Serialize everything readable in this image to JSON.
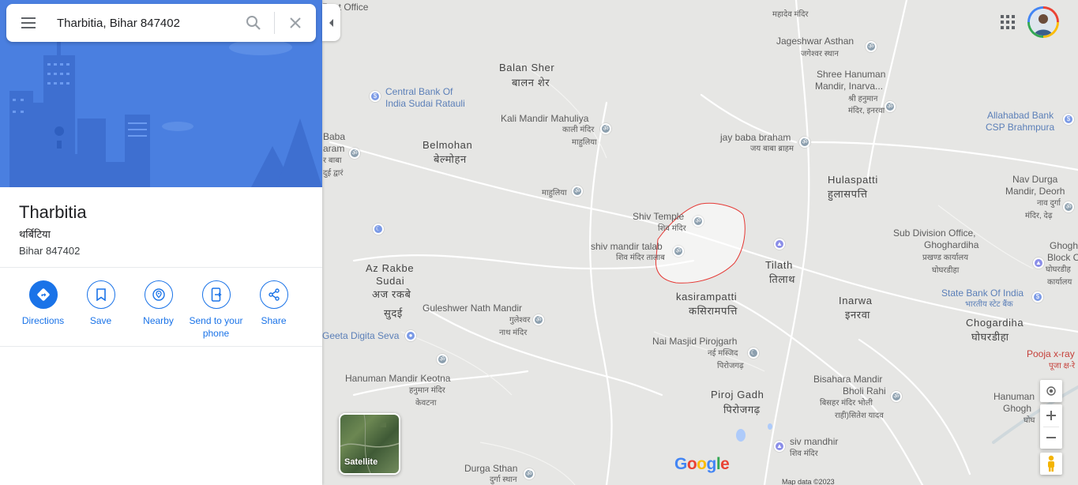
{
  "search": {
    "value": "Tharbitia, Bihar 847402"
  },
  "place": {
    "title": "Tharbitia",
    "local_name": "थर्बिटिया",
    "address": "Bihar 847402"
  },
  "actions": [
    {
      "label": "Directions",
      "icon": "directions-icon"
    },
    {
      "label": "Save",
      "icon": "bookmark-icon"
    },
    {
      "label": "Nearby",
      "icon": "nearby-icon"
    },
    {
      "label": "Send to your phone",
      "icon": "send-to-phone-icon"
    },
    {
      "label": "Share",
      "icon": "share-icon"
    }
  ],
  "map": {
    "satellite_label": "Satellite",
    "google_logo": "Google",
    "footer": "Map data ©2023",
    "labels": {
      "post_office": "Post Office",
      "mahadev_mandir": "महादेव मंदिर",
      "jageshwar_asthan": "Jageshwar Asthan",
      "jageshwar_hi": "जगेश्वर स्थान",
      "balan_sher": "Balan Sher",
      "balan_sher_hi": "बालन शेर",
      "central_bank_1": "Central Bank Of",
      "central_bank_2": "India Sudai Ratauli",
      "shree_hanuman_1": "Shree Hanuman",
      "shree_hanuman_2": "Mandir, Inarva...",
      "shree_hanuman_hi1": "श्री हनुमान",
      "shree_hanuman_hi2": "मंदिर, इनरवा",
      "allahabad_1": "Allahabad Bank",
      "allahabad_2": "CSP Brahmpura",
      "kali_mandir": "Kali Mandir Mahuliya",
      "kali_mandir_hi1": "काली मंदिर",
      "kali_mandir_hi2": "माहुलिया",
      "baba_1": "Baba",
      "baba_2": "aram",
      "baba_3": "र बाबा",
      "baba_4": "दुई द्वारं",
      "belmohan": "Belmohan",
      "belmohan_hi": "बेल्मोहन",
      "jay_baba": "jay baba braham",
      "jay_baba_hi": "जय बाबा ब्राहम",
      "hulaspatti": "Hulaspatti",
      "hulaspatti_hi": "हुलासपत्ति",
      "nav_durga_1": "Nav Durga",
      "nav_durga_2": "Mandir, Deorh",
      "nav_durga_hi1": "नाव दुर्गा",
      "nav_durga_hi2": "मंदिर, देढ़",
      "mahuliya_hi": "माहुलिया",
      "shiv_temple": "Shiv Temple",
      "shiv_temple_hi": "शिव मंदिर",
      "shiv_talab": "shiv mandir talab",
      "shiv_talab_hi": "शिव मंदिर तालाब",
      "sub_division_1": "Sub Division Office,",
      "sub_division_2": "Ghoghardiha",
      "sub_division_hi1": "प्रखण्ड कार्यालय",
      "sub_division_hi2": "घोघरडीहा",
      "ghogh_block_1": "Ghogh",
      "ghogh_block_2": "Block C",
      "ghogh_block_hi1": "घोघरडीह",
      "ghogh_block_hi2": "कार्यालय",
      "az_rakbe_1": "Az Rakbe",
      "az_rakbe_2": "Sudai",
      "az_rakbe_hi1": "अज रकबे",
      "az_rakbe_hi2": "सुदई",
      "tilath": "Tilath",
      "tilath_hi": "तिलाथ",
      "kasirampatti": "kasirampatti",
      "kasirampatti_hi": "कसिरामपत्ति",
      "inarwa": "Inarwa",
      "inarwa_hi": "इनरवा",
      "sbi": "State Bank Of India",
      "sbi_hi": "भारतीय स्टेट बैंक",
      "chogardiha": "Chogardiha",
      "chogardiha_hi": "घोघरडीहा",
      "guleshwer": "Guleshwer Nath Mandir",
      "guleshwer_hi1": "गुलेश्वर",
      "guleshwer_hi2": "नाथ मंदिर",
      "geeta": "Geeta Digita Seva",
      "nai_masjid": "Nai Masjid Pirojgarh",
      "nai_masjid_hi1": "नई मस्जिद",
      "nai_masjid_hi2": "पिरोजगढ़",
      "pooja_1": "Pooja x-ray",
      "pooja_2": "पूजा क्ष-रे",
      "hanuman_keotna": "Hanuman Mandir Keotna",
      "hanuman_keotna_hi1": "हनुमान मंदिर",
      "hanuman_keotna_hi2": "केवटना",
      "piroj_gadh": "Piroj Gadh",
      "piroj_gadh_hi": "पिरोजगढ़",
      "bisahara_1": "Bisahara Mandir",
      "bisahara_2": "Bholi Rahi",
      "bisahara_hi1": "बिसहर मंदिर भोली",
      "bisahara_hi2": "राही)सितेश यादव",
      "hanuman_ghogh_1": "Hanuman",
      "hanuman_ghogh_2": "Ghogh",
      "hanuman_ghogh_3": "घोघ",
      "siv_mandhir": "siv mandhir",
      "siv_mandhir_hi": "शिव मंदिर",
      "durga_sthan": "Durga Sthan",
      "durga_sthan_hi": "दुर्गा स्थान"
    }
  },
  "colors": {
    "accent": "#1a73e8",
    "map_bg": "#e6e6e4",
    "hero_bg": "#4a7fe0",
    "boundary": "#e53935"
  }
}
